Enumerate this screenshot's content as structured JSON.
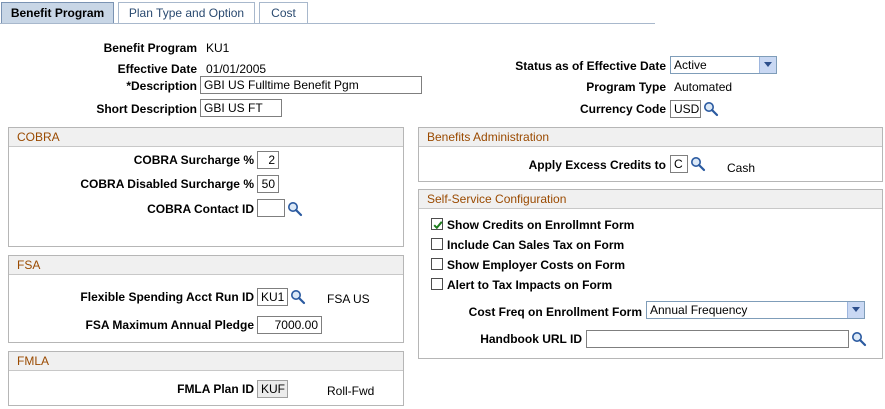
{
  "tabs": [
    {
      "label": "Benefit Program",
      "active": true
    },
    {
      "label": "Plan Type and Option",
      "active": false
    },
    {
      "label": "Cost",
      "active": false
    }
  ],
  "header": {
    "benefit_program_label": "Benefit Program",
    "benefit_program_value": "KU1",
    "effective_date_label": "Effective Date",
    "effective_date_value": "01/01/2005",
    "description_label": "*Description",
    "description_value": "GBI US Fulltime Benefit Pgm",
    "short_description_label": "Short Description",
    "short_description_value": "GBI US FT",
    "status_label": "Status as of Effective Date",
    "status_value": "Active",
    "program_type_label": "Program Type",
    "program_type_value": "Automated",
    "currency_label": "Currency Code",
    "currency_value": "USD"
  },
  "cobra": {
    "title": "COBRA",
    "surcharge_label": "COBRA Surcharge %",
    "surcharge_value": "2",
    "disabled_surcharge_label": "COBRA Disabled Surcharge %",
    "disabled_surcharge_value": "50",
    "contact_label": "COBRA Contact ID",
    "contact_value": ""
  },
  "fsa": {
    "title": "FSA",
    "run_id_label": "Flexible Spending Acct Run ID",
    "run_id_value": "KU1",
    "run_id_desc": "FSA US",
    "max_pledge_label": "FSA Maximum Annual Pledge",
    "max_pledge_value": "7000.00"
  },
  "fmla": {
    "title": "FMLA",
    "plan_id_label": "FMLA Plan ID",
    "plan_id_value": "KUF",
    "plan_id_desc": "Roll-Fwd"
  },
  "benefits_admin": {
    "title": "Benefits Administration",
    "excess_credits_label": "Apply Excess Credits to",
    "excess_credits_value": "C",
    "excess_credits_desc": "Cash"
  },
  "self_service": {
    "title": "Self-Service Configuration",
    "checkboxes": [
      {
        "label": "Show Credits on Enrollmnt Form",
        "checked": true
      },
      {
        "label": "Include Can Sales Tax on Form",
        "checked": false
      },
      {
        "label": "Show Employer Costs on Form",
        "checked": false
      },
      {
        "label": "Alert to Tax Impacts on Form",
        "checked": false
      }
    ],
    "cost_freq_label": "Cost Freq on Enrollment Form",
    "cost_freq_value": "Annual Frequency",
    "handbook_label": "Handbook URL ID",
    "handbook_value": ""
  },
  "colors": {
    "group_title": "#9a4a00",
    "tab_active_bg": "#c8d6e6",
    "tab_text": "#2a4a70"
  }
}
